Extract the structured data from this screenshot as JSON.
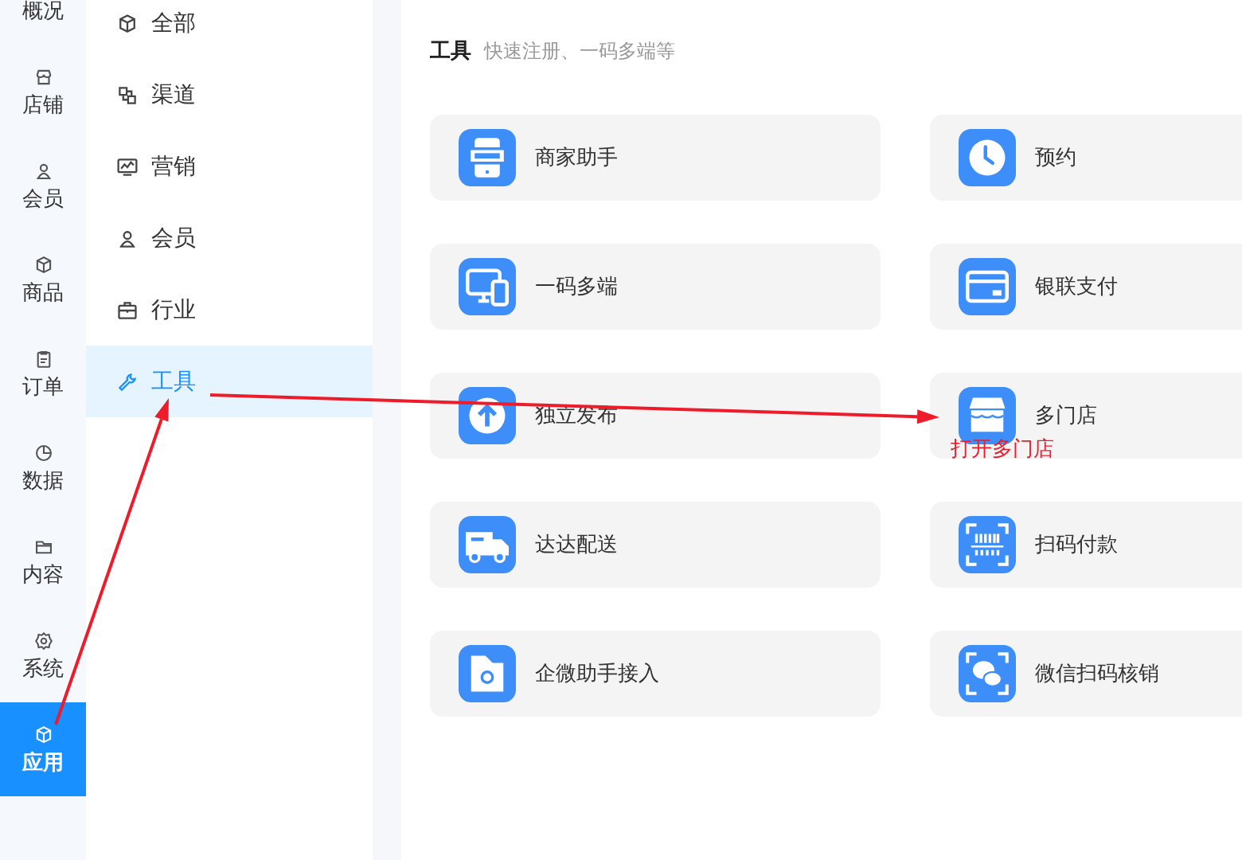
{
  "rail": [
    {
      "label": "概况",
      "selected": false
    },
    {
      "label": "店铺",
      "selected": false
    },
    {
      "label": "会员",
      "selected": false
    },
    {
      "label": "商品",
      "selected": false
    },
    {
      "label": "订单",
      "selected": false
    },
    {
      "label": "数据",
      "selected": false
    },
    {
      "label": "内容",
      "selected": false
    },
    {
      "label": "系统",
      "selected": false
    },
    {
      "label": "应用",
      "selected": true
    }
  ],
  "categories": [
    {
      "label": "全部",
      "selected": false
    },
    {
      "label": "渠道",
      "selected": false
    },
    {
      "label": "营销",
      "selected": false
    },
    {
      "label": "会员",
      "selected": false
    },
    {
      "label": "行业",
      "selected": false
    },
    {
      "label": "工具",
      "selected": true
    }
  ],
  "section": {
    "title": "工具",
    "subtitle": "快速注册、一码多端等"
  },
  "tools": [
    {
      "label": "商家助手"
    },
    {
      "label": "预约"
    },
    {
      "label": "一码多端"
    },
    {
      "label": "银联支付"
    },
    {
      "label": "独立发布"
    },
    {
      "label": "多门店"
    },
    {
      "label": "达达配送"
    },
    {
      "label": "扫码付款"
    },
    {
      "label": "企微助手接入"
    },
    {
      "label": "微信扫码核销"
    }
  ],
  "annotation": {
    "text": "打开多门店"
  }
}
